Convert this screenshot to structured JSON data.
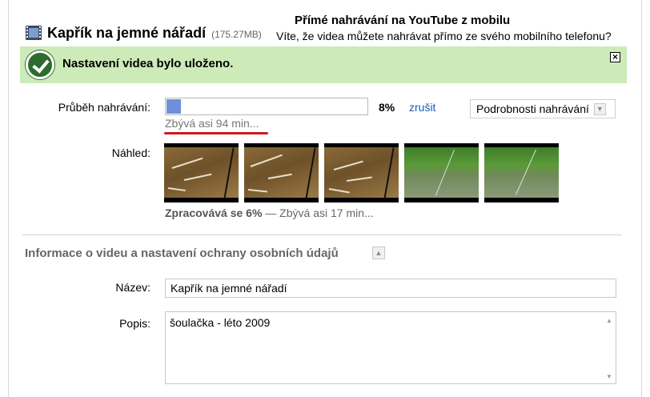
{
  "header": {
    "video_title": "Kapřík na jemné nářadí",
    "video_size": "(175.27MB)",
    "promo_title": "Přímé nahrávání na YouTube z mobilu",
    "promo_text": "Víte, že videa můžete nahrávat přímo ze svého mobilního telefonu?"
  },
  "notification": {
    "message": "Nastavení videa bylo uloženo.",
    "close_icon": "close-icon",
    "status_icon": "check-circle-icon",
    "color": "#ccebb8"
  },
  "upload": {
    "label": "Průběh nahrávání:",
    "progress_percent": 8,
    "percent_text": "8%",
    "cancel_label": "zrušit",
    "remaining": "Zbývá asi 94 min...",
    "details_label": "Podrobnosti nahrávání",
    "bar_color": "#6f8fdc"
  },
  "preview": {
    "label": "Náhled:",
    "thumbnails": [
      "brown-water",
      "brown-water",
      "brown-water",
      "green-pond",
      "green-pond"
    ],
    "processing_bold": "Zpracovává se 6%",
    "processing_rest": " — Zbývá asi 17 min..."
  },
  "info_section": {
    "title": "Informace o videu a nastavení ochrany osobních údajů",
    "name_label": "Název:",
    "name_value": "Kapřík na jemné nářadí",
    "desc_label": "Popis:",
    "desc_value": "šoulačka - léto 2009"
  }
}
